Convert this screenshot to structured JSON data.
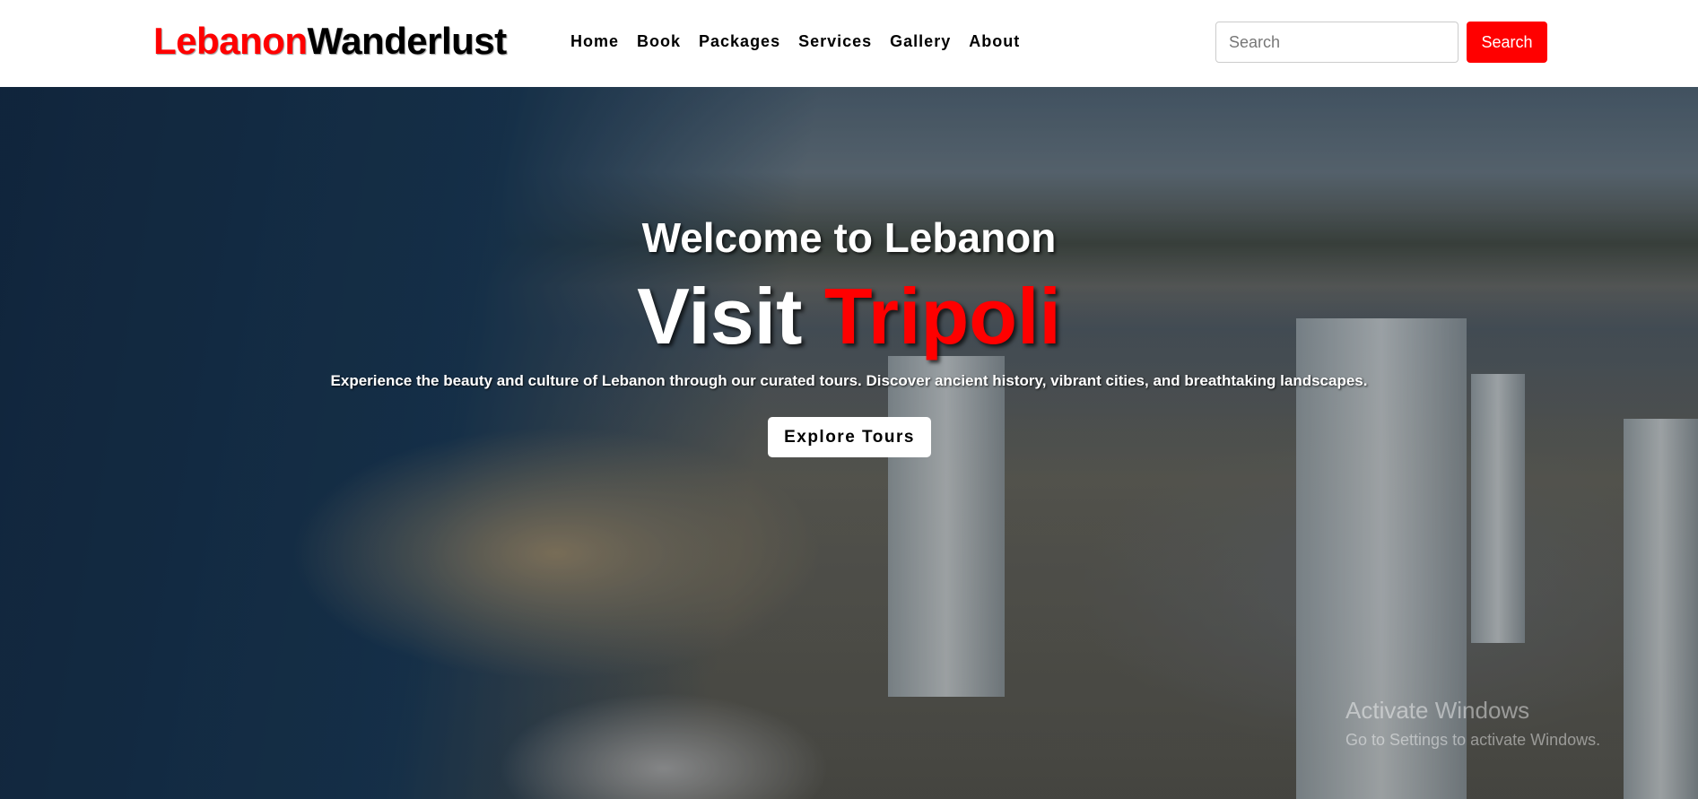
{
  "brand": {
    "part1": "Lebanon",
    "part2": "Wanderlust",
    "accent": "#ff0000"
  },
  "nav": [
    {
      "label": "Home"
    },
    {
      "label": "Book"
    },
    {
      "label": "Packages"
    },
    {
      "label": "Services"
    },
    {
      "label": "Gallery"
    },
    {
      "label": "About"
    }
  ],
  "search": {
    "placeholder": "Search",
    "button": "Search"
  },
  "hero": {
    "welcome": "Welcome to Lebanon",
    "visit": "Visit",
    "city": "Tripoli",
    "description": "Experience the beauty and culture of Lebanon through our curated tours. Discover ancient history, vibrant cities, and breathtaking landscapes.",
    "cta": "Explore Tours"
  },
  "watermark": {
    "title": "Activate Windows",
    "subtitle": "Go to Settings to activate Windows."
  }
}
